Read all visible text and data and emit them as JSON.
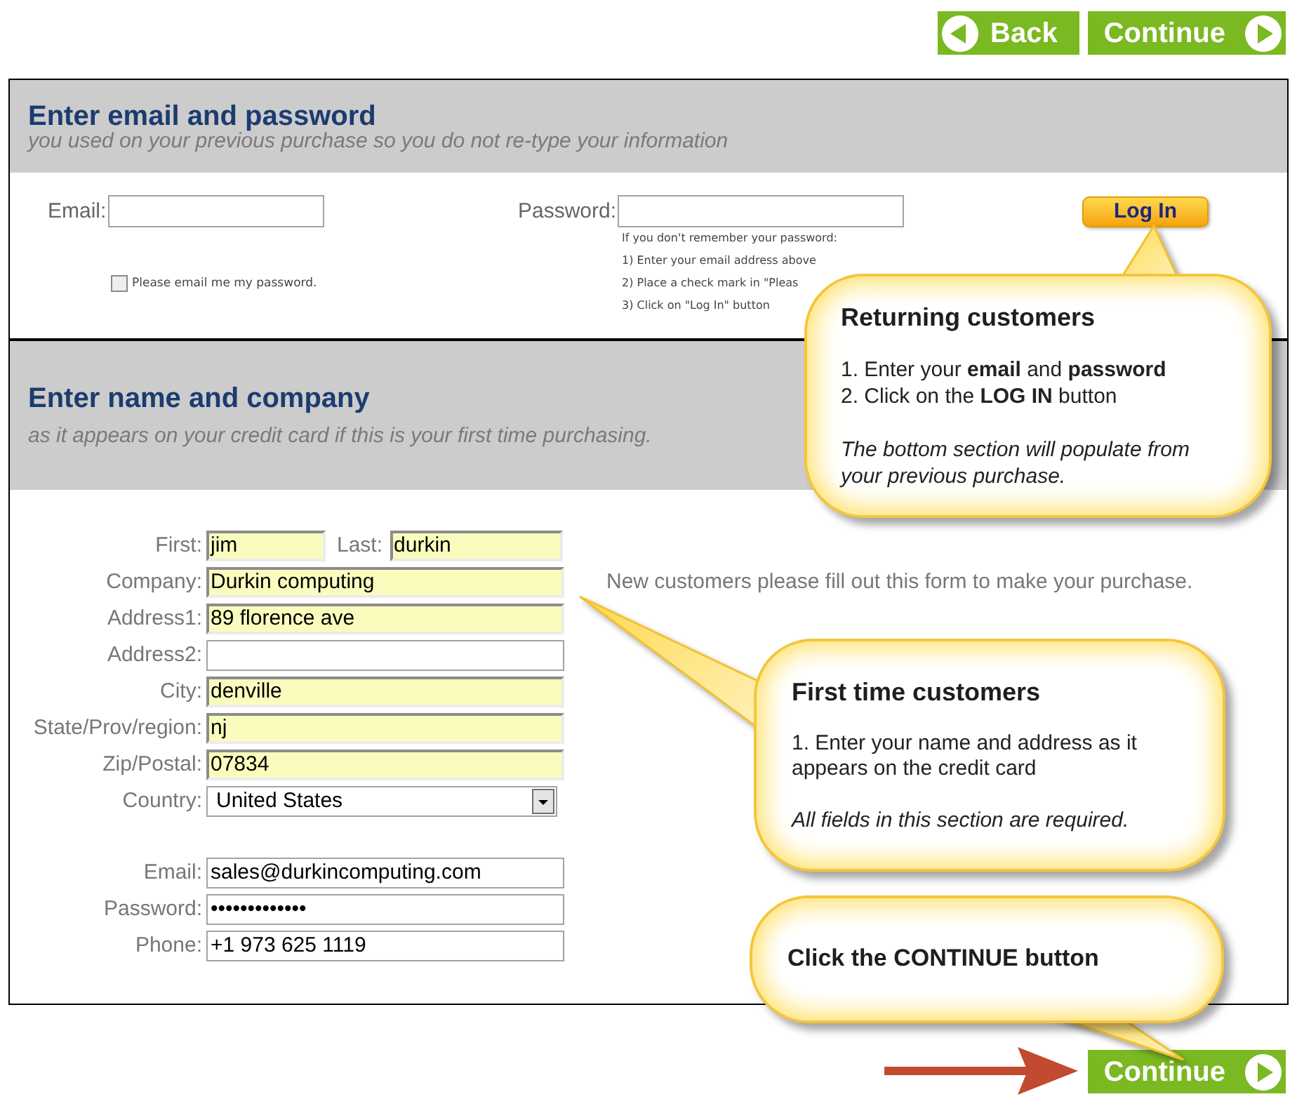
{
  "nav_buttons": [
    {
      "kind": "back",
      "label": "Back"
    },
    {
      "kind": "next",
      "label": "Continue"
    }
  ],
  "login_section": {
    "title": "Enter email and password",
    "subtitle": "you used on your previous purchase so you do not re-type your information",
    "email_label": "Email:",
    "password_label": "Password:",
    "email_me": {
      "label": "Please email me my password.",
      "checked": false
    },
    "hint_lines": [
      "If you don't remember your password:",
      "1) Enter your email address above",
      "2) Place a check mark in \"Pleas",
      "3) Click on \"Log In\" button"
    ],
    "login_button": "Log In"
  },
  "name_section": {
    "title": "Enter name and company",
    "subtitle": "as it appears on your credit card if this is your first time purchasing.",
    "note": "New customers please fill out this form to make your purchase.",
    "first": {
      "label": "First:",
      "value": "jim",
      "autofilled": true
    },
    "last": {
      "label": "Last:",
      "value": "durkin",
      "autofilled": true
    },
    "address_rows": [
      {
        "kind": "text",
        "label": "Company:",
        "value": "Durkin computing",
        "autofilled": true
      },
      {
        "kind": "text",
        "label": "Address1:",
        "value": "89 florence ave",
        "autofilled": true
      },
      {
        "kind": "text",
        "label": "Address2:",
        "autofilled": false
      },
      {
        "kind": "text",
        "label": "City:",
        "value": "denville",
        "autofilled": true
      },
      {
        "kind": "text",
        "label": "State/Prov/region:",
        "value": "nj",
        "autofilled": true
      },
      {
        "kind": "text",
        "label": "Zip/Postal:",
        "value": "07834",
        "autofilled": true
      },
      {
        "kind": "select",
        "label": "Country:",
        "value": "United States",
        "autofilled": false
      }
    ],
    "account_rows": [
      {
        "label": "Email:",
        "value": "sales@durkincomputing.com",
        "autofilled": false
      },
      {
        "label": "Password:",
        "masked_value": "•••••••••••••",
        "autofilled": false
      },
      {
        "label": "Phone:",
        "value": "+1 973 625 1119",
        "autofilled": false
      }
    ]
  },
  "callouts": [
    {
      "title": "Returning customers",
      "steps": [
        "1. Enter your **email** and **password**",
        "2. Click on the **LOG IN** button"
      ],
      "note": "The bottom section will populate from your previous purchase."
    },
    {
      "title": "First time customers",
      "steps": [
        "1. Enter your name and address as it appears on the credit card"
      ],
      "note": "All fields in this section are required."
    },
    {
      "title": "Click the CONTINUE button"
    }
  ],
  "bottom_button": {
    "kind": "next",
    "label": "Continue"
  }
}
